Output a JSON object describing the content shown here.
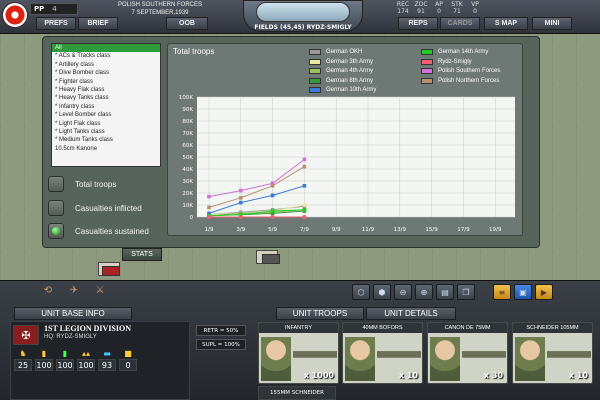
{
  "top": {
    "pp_label": "PP",
    "pp_value": "4",
    "buttons": {
      "prefs": "PREFS",
      "brief": "BRIEF",
      "oob": "OOB",
      "reps": "REPS",
      "cards": "CARDS",
      "smap": "S MAP",
      "mini": "MINI"
    },
    "title_line1": "POLISH SOUTHERN FORCES",
    "title_line2": "7 SEPTEMBER,1939",
    "hex_location": "FIELDS (45,45) RYDZ-SMIGLY",
    "stat_headers": [
      "REC",
      "ZOC",
      "AP",
      "STK",
      "VP"
    ],
    "stat_values": [
      "174",
      "91",
      "0",
      "71",
      "0"
    ]
  },
  "unit_class_list": {
    "items": [
      "All",
      "* ACs & Tracks class",
      "* Artillery class",
      "* Dive Bomber class",
      "* Fighter class",
      "* Heavy Flak class",
      "* Heavy Tanks class",
      "* Infantry class",
      "* Level Bomber class",
      "* Light Flak class",
      "* Light Tanks class",
      "* Medium Tanks class",
      "10.5cm Kanone"
    ],
    "selected_index": 0
  },
  "options": [
    {
      "label": "Total troops",
      "selected": false
    },
    {
      "label": "Casualties inflicted",
      "selected": false
    },
    {
      "label": "Casualties sustained",
      "selected": true
    }
  ],
  "stats_tab": "STATS",
  "chart_data": {
    "type": "line",
    "title": "Total troops",
    "categories": [
      "1/9",
      "3/9",
      "5/9",
      "7/9",
      "9/9",
      "11/9",
      "13/9",
      "15/9",
      "17/9",
      "19/9"
    ],
    "yticks": [
      "100K",
      "90K",
      "80K",
      "70K",
      "60K",
      "50K",
      "40K",
      "30K",
      "20K",
      "10K",
      "0"
    ],
    "ylim": [
      0,
      100000
    ],
    "grid": true,
    "series": [
      {
        "name": "German OKH",
        "color": "#9a9a9a",
        "values": [
          2000,
          4000,
          6000,
          9000
        ]
      },
      {
        "name": "German 3th Army",
        "color": "#e8e8a0",
        "values": [
          2000,
          3000,
          5000,
          10000
        ]
      },
      {
        "name": "German 4th Army",
        "color": "#a0c060",
        "values": [
          1000,
          3000,
          4000,
          6000
        ]
      },
      {
        "name": "German 8th Army",
        "color": "#3a9a3a",
        "values": [
          1000,
          2000,
          3000,
          5000
        ]
      },
      {
        "name": "German 10th Army",
        "color": "#3a7ad8",
        "values": [
          3000,
          12000,
          18000,
          26000
        ]
      },
      {
        "name": "German 14th Army",
        "color": "#22cc22",
        "values": [
          1000,
          2000,
          5000,
          6000
        ]
      },
      {
        "name": "Rydz-Smigly",
        "color": "#f06070",
        "values": [
          0,
          0,
          0,
          0
        ]
      },
      {
        "name": "Polish Southern Forces",
        "color": "#d070d8",
        "values": [
          17000,
          22000,
          28000,
          48000
        ]
      },
      {
        "name": "Polish Northern Forces",
        "color": "#b89070",
        "values": [
          8000,
          16000,
          26000,
          42000
        ]
      }
    ]
  },
  "bottom": {
    "tabs": {
      "unit_base_info": "UNIT BASE INFO",
      "unit_troops": "UNIT TROOPS",
      "unit_details": "UNIT DETAILS"
    },
    "unit_name": "1ST LEGION DIVISION",
    "unit_hq": "HQ: RYDZ-SMIGLY",
    "unit_stats": [
      "25",
      "100",
      "100",
      "100",
      "93",
      "0"
    ],
    "retr": "RETR = 50%",
    "supl": "SUPL = 100%",
    "troop_cards": [
      {
        "name": "INFANTRY",
        "count": "x 1000"
      },
      {
        "name": "40MM BOFORS",
        "count": "x 10"
      },
      {
        "name": "CANON DE 75MM",
        "count": "x 30"
      },
      {
        "name": "SCHNEIDER 105MM",
        "count": "x 10"
      }
    ],
    "extra_card": "155MM SCHNEIDER"
  }
}
